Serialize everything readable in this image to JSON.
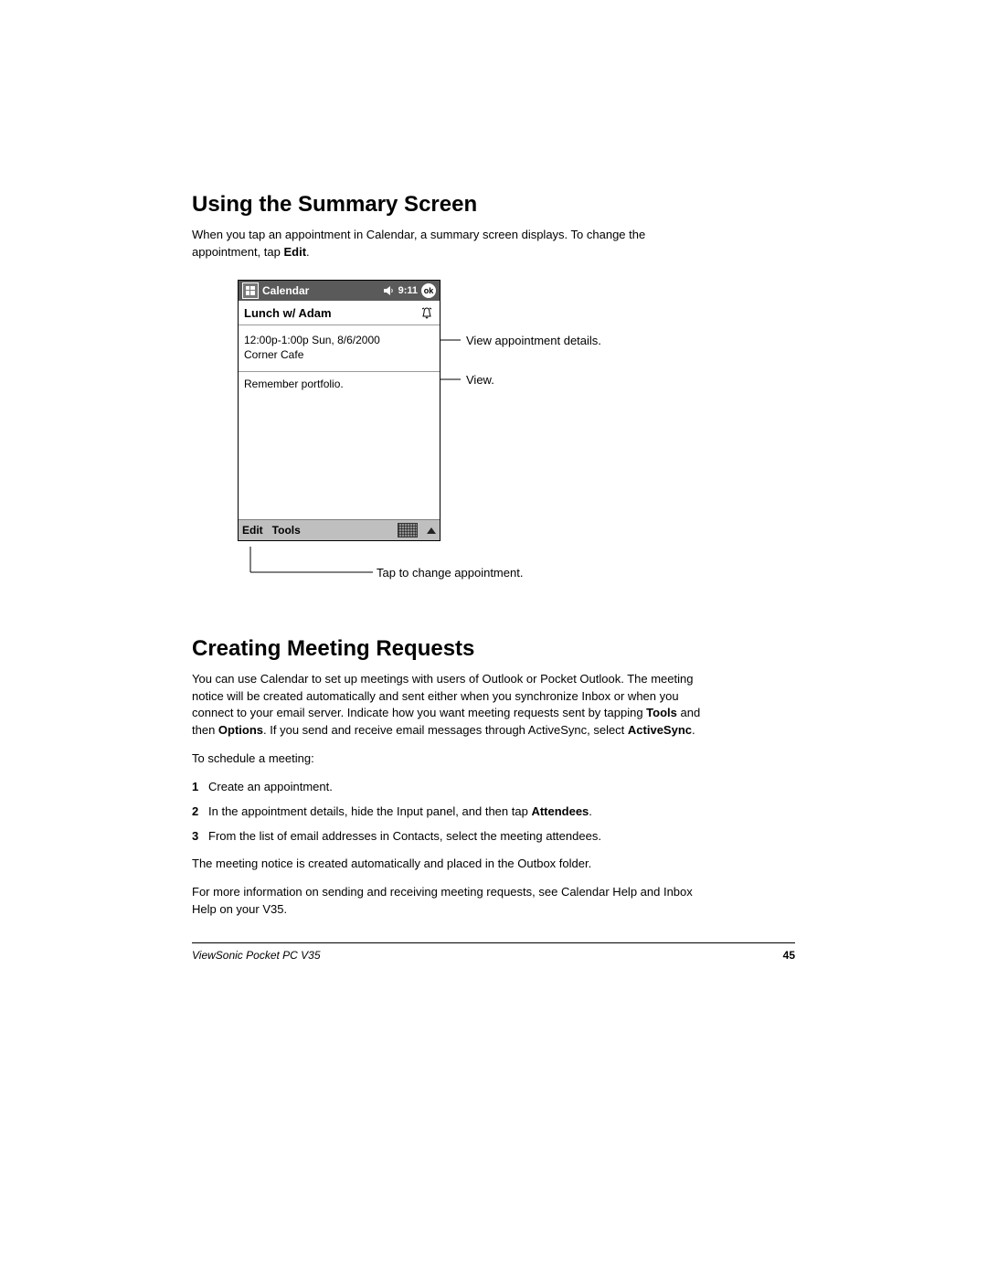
{
  "section1": {
    "heading": "Using the Summary Screen",
    "intro_pre": "When you tap an appointment in Calendar, a summary screen displays. To change the appointment, tap ",
    "intro_bold": "Edit",
    "intro_post": "."
  },
  "ppc": {
    "app_title": "Calendar",
    "time": "9:11",
    "ok_label": "ok",
    "subject": "Lunch w/ Adam",
    "detail_time": "12:00p-1:00p Sun, 8/6/2000",
    "detail_loc": "Corner Cafe",
    "notes": "Remember portfolio.",
    "menu_edit": "Edit",
    "menu_tools": "Tools"
  },
  "callouts": {
    "c_details": "View appointment details.",
    "c_notes": "View.",
    "c_edit": "Tap to change appointment."
  },
  "section2": {
    "heading": "Creating Meeting Requests",
    "para1_a": "You can use Calendar to set up meetings with users of Outlook or Pocket Outlook. The meeting notice will be created automatically and sent either when you synchronize Inbox or when you connect to your email server. Indicate how you want meeting requests sent by tapping ",
    "para1_b1": "Tools",
    "para1_c": " and then ",
    "para1_b2": "Options",
    "para1_d": ". If you send and receive email messages through ActiveSync, select ",
    "para1_b3": "ActiveSync",
    "para1_e": ".",
    "schedule_intro": "To schedule a meeting:",
    "steps": {
      "s1": "Create an appointment.",
      "s2_a": "In the appointment details, hide the Input panel, and then tap ",
      "s2_b": "Attendees",
      "s2_c": ".",
      "s3": "From the list of email addresses in Contacts, select the meeting attendees."
    },
    "after1": "The meeting notice is created automatically and placed in the Outbox folder.",
    "after2": "For more information on sending and receiving meeting requests, see Calendar Help and Inbox Help on your V35."
  },
  "footer": {
    "product": "ViewSonic Pocket PC  V35",
    "page": "45"
  }
}
